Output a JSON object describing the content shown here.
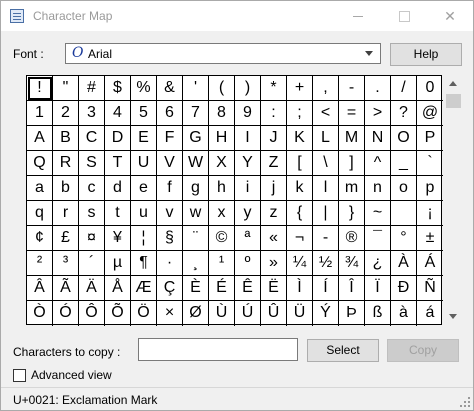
{
  "window": {
    "title": "Character Map"
  },
  "font": {
    "label": "Font :",
    "selected": "Arial",
    "glyph": "O"
  },
  "buttons": {
    "help": "Help",
    "select": "Select",
    "copy": "Copy"
  },
  "grid": {
    "selected_index": 0,
    "characters": [
      "!",
      "\"",
      "#",
      "$",
      "%",
      "&",
      "'",
      "(",
      ")",
      "*",
      "+",
      ",",
      "-",
      ".",
      "/",
      "0",
      "1",
      "2",
      "3",
      "4",
      "5",
      "6",
      "7",
      "8",
      "9",
      ":",
      ";",
      "<",
      "=",
      ">",
      "?",
      "@",
      "A",
      "B",
      "C",
      "D",
      "E",
      "F",
      "G",
      "H",
      "I",
      "J",
      "K",
      "L",
      "M",
      "N",
      "O",
      "P",
      "Q",
      "R",
      "S",
      "T",
      "U",
      "V",
      "W",
      "X",
      "Y",
      "Z",
      "[",
      "\\",
      "]",
      "^",
      "_",
      "`",
      "a",
      "b",
      "c",
      "d",
      "e",
      "f",
      "g",
      "h",
      "i",
      "j",
      "k",
      "l",
      "m",
      "n",
      "o",
      "p",
      "q",
      "r",
      "s",
      "t",
      "u",
      "v",
      "w",
      "x",
      "y",
      "z",
      "{",
      "|",
      "}",
      "~",
      " ",
      "¡",
      "¢",
      "£",
      "¤",
      "¥",
      "¦",
      "§",
      "¨",
      "©",
      "ª",
      "«",
      "¬",
      "-",
      "®",
      "¯",
      "°",
      "±",
      "²",
      "³",
      "´",
      "µ",
      "¶",
      "·",
      "¸",
      "¹",
      "º",
      "»",
      "¼",
      "½",
      "¾",
      "¿",
      "À",
      "Á",
      "Â",
      "Ã",
      "Ä",
      "Å",
      "Æ",
      "Ç",
      "È",
      "É",
      "Ê",
      "Ë",
      "Ì",
      "Í",
      "Î",
      "Ï",
      "Ð",
      "Ñ",
      "Ò",
      "Ó",
      "Ô",
      "Õ",
      "Ö",
      "×",
      "Ø",
      "Ù",
      "Ú",
      "Û",
      "Ü",
      "Ý",
      "Þ",
      "ß",
      "à",
      "á"
    ]
  },
  "copy": {
    "label": "Characters to copy :",
    "value": ""
  },
  "advanced": {
    "label": "Advanced view",
    "checked": false
  },
  "status": {
    "text": "U+0021: Exclamation Mark"
  }
}
